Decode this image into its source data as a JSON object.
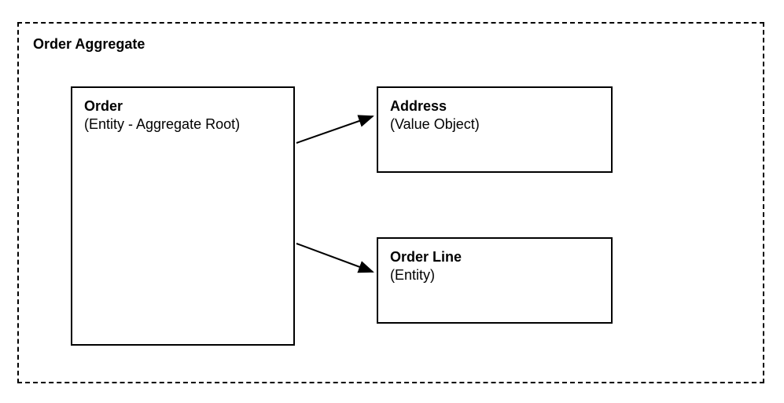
{
  "aggregate": {
    "title": "Order Aggregate"
  },
  "boxes": {
    "order": {
      "title": "Order",
      "subtitle": "(Entity - Aggregate Root)"
    },
    "address": {
      "title": "Address",
      "subtitle": "(Value Object)"
    },
    "orderline": {
      "title": "Order Line",
      "subtitle": "(Entity)"
    }
  }
}
